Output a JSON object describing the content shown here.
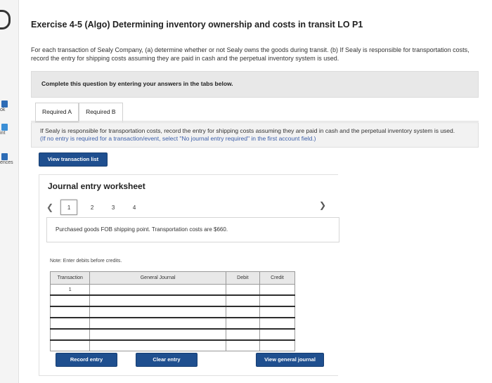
{
  "sidebar": {
    "items": [
      {
        "label": "ok",
        "icon": "book-icon",
        "color": "#2d6cb5"
      },
      {
        "label": "int",
        "icon": "print-icon",
        "color": "#3b8fd6"
      },
      {
        "label": "ences",
        "icon": "references-icon",
        "color": "#2d6cb5"
      }
    ]
  },
  "exercise": {
    "title": "Exercise 4-5 (Algo) Determining inventory ownership and costs in transit LO P1",
    "intro": "For each transaction of Sealy Company, (a) determine whether or not Sealy owns the goods during transit. (b) If Sealy is responsible for transportation costs, record the entry for shipping costs assuming they are paid in cash and the perpetual inventory system is used."
  },
  "instructions": "Complete this question by entering your answers in the tabs below.",
  "tabs": [
    {
      "label": "Required A",
      "active": false
    },
    {
      "label": "Required B",
      "active": true
    }
  ],
  "required_b": {
    "text": "If Sealy is responsible for transportation costs, record the entry for shipping costs assuming they are paid in cash and the perpetual inventory system is used.",
    "hint": "(If no entry is required for a transaction/event, select \"No journal entry required\" in the first account field.)"
  },
  "buttons": {
    "view_transactions": "View transaction list",
    "record_entry": "Record entry",
    "clear_entry": "Clear entry",
    "view_journal": "View general journal",
    "accent_color": "#1f4f8f"
  },
  "worksheet": {
    "title": "Journal entry worksheet",
    "pages": [
      "1",
      "2",
      "3",
      "4"
    ],
    "current_page": "1",
    "description": "Purchased goods FOB shipping point. Transportation costs are $660.",
    "note": "Note: Enter debits before credits."
  },
  "journal_table": {
    "headers": [
      "Transaction",
      "General Journal",
      "Debit",
      "Credit"
    ],
    "rows": [
      [
        "1",
        "",
        "",
        ""
      ],
      [
        "",
        "",
        "",
        ""
      ],
      [
        "",
        "",
        "",
        ""
      ],
      [
        "",
        "",
        "",
        ""
      ],
      [
        "",
        "",
        "",
        ""
      ],
      [
        "",
        "",
        "",
        ""
      ]
    ]
  }
}
